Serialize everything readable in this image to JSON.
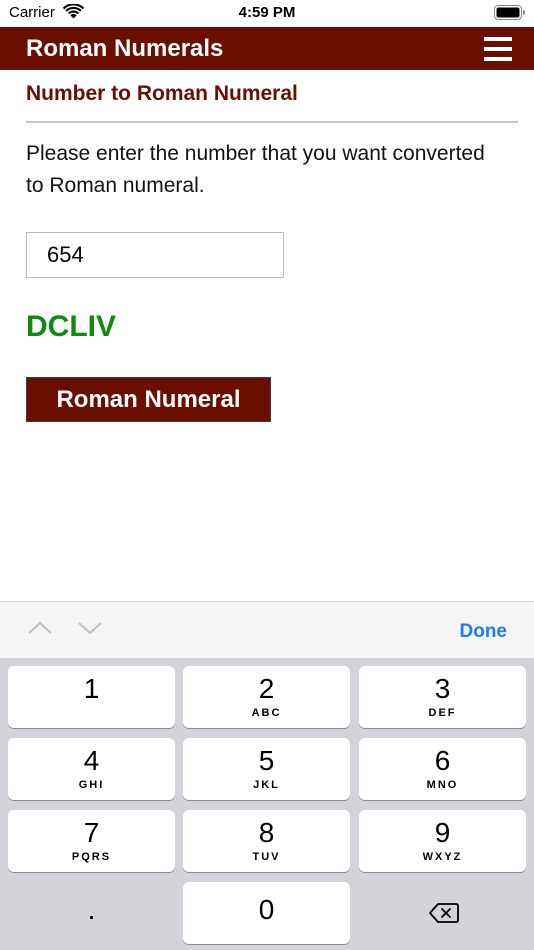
{
  "status_bar": {
    "carrier": "Carrier",
    "time": "4:59 PM"
  },
  "nav": {
    "title": "Roman Numerals",
    "menu_icon": "hamburger-menu-icon",
    "background_color": "#6a0e00"
  },
  "converter": {
    "heading": "Number to Roman Numeral",
    "instructions": "Please enter the number that you want converted to Roman numeral.",
    "input_value": "654",
    "result": "DCLIV",
    "result_color": "#0e8a0e",
    "button_label": "Roman Numeral"
  },
  "keyboard": {
    "toolbar": {
      "prev_icon": "chevron-up-icon",
      "next_icon": "chevron-down-icon",
      "done_label": "Done"
    },
    "keys": [
      {
        "digit": "1",
        "letters": ""
      },
      {
        "digit": "2",
        "letters": "ABC"
      },
      {
        "digit": "3",
        "letters": "DEF"
      },
      {
        "digit": "4",
        "letters": "GHI"
      },
      {
        "digit": "5",
        "letters": "JKL"
      },
      {
        "digit": "6",
        "letters": "MNO"
      },
      {
        "digit": "7",
        "letters": "PQRS"
      },
      {
        "digit": "8",
        "letters": "TUV"
      },
      {
        "digit": "9",
        "letters": "WXYZ"
      },
      {
        "digit": "0",
        "letters": ""
      }
    ],
    "decimal_key": ".",
    "delete_icon": "backspace-icon"
  }
}
